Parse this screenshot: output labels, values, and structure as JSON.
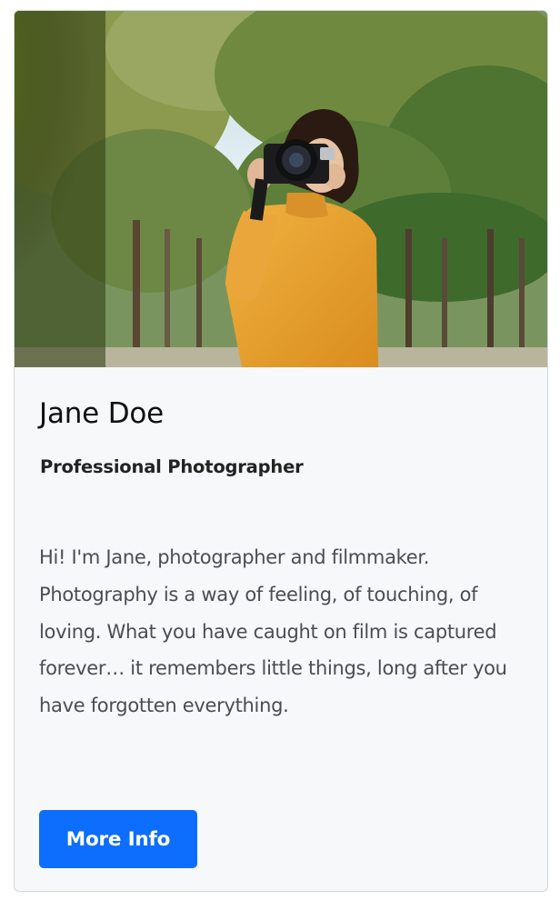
{
  "card": {
    "image": {
      "alt": "Woman in an orange sweater taking a photo with a camera among trees"
    },
    "name": "Jane Doe",
    "title": "Professional Photographer",
    "bio": "Hi! I'm Jane, photographer and filmmaker. Photography is a way of feeling, of touching, of loving. What you have caught on film is captured forever… it remembers little things, long after you have forgotten everything.",
    "button_label": "More Info"
  },
  "colors": {
    "primary": "#0d6efd",
    "card_background": "#f7f8fa",
    "card_border": "#d3d6da",
    "sweater": "#e6a02e"
  }
}
